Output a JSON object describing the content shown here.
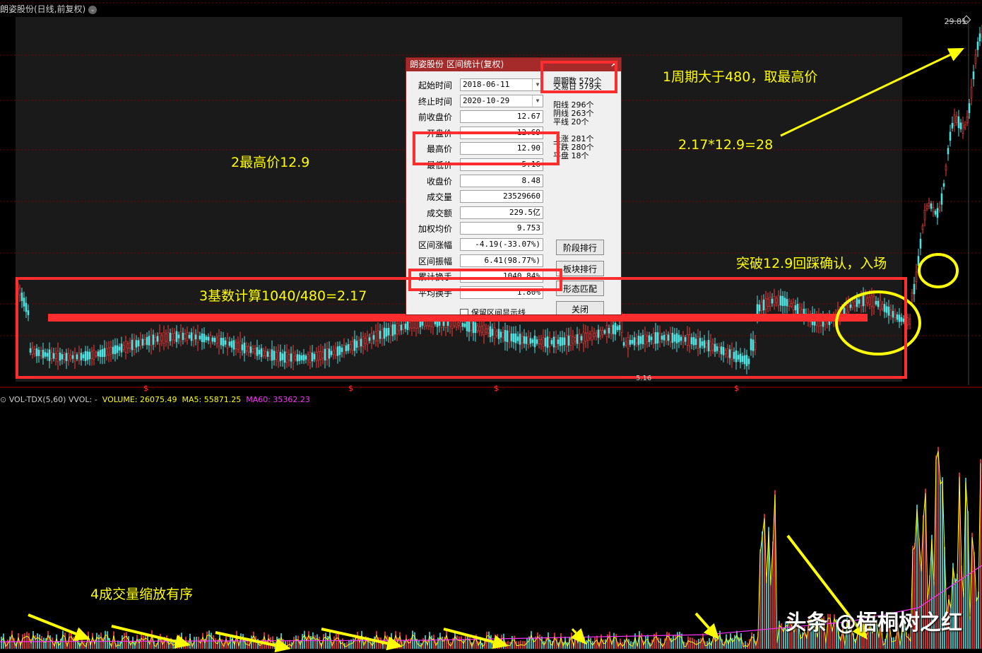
{
  "header": {
    "stock_title": "朗姿股份(日线,前复权)",
    "menu_icon": "chevron-down-icon"
  },
  "price_axis": {
    "high_label": "29.81"
  },
  "volume_header": {
    "indicator": "VOL-TDX(5,60)",
    "vvol": "VVOL: -",
    "volume": "VOLUME: 26075.49",
    "ma5": "MA5: 55871.25",
    "ma60": "MA60: 35362.23",
    "colors": {
      "volume": "#ffff00",
      "ma5": "#ffff00",
      "ma60": "#ff33ff",
      "label": "#cfcfcf"
    }
  },
  "dialog": {
    "title": "朗姿股份 区间统计(复权)",
    "close_icon": "close-icon",
    "rows": [
      {
        "label": "起始时间",
        "value": "2018-06-11",
        "type": "date"
      },
      {
        "label": "终止时间",
        "value": "2020-10-29",
        "type": "date"
      },
      {
        "label": "前收盘价",
        "value": "12.67",
        "type": "field"
      },
      {
        "label": "开盘价",
        "value": "12.69",
        "type": "field"
      },
      {
        "label": "最高价",
        "value": "12.90",
        "type": "field"
      },
      {
        "label": "最低价",
        "value": "5.16",
        "type": "field"
      },
      {
        "label": "收盘价",
        "value": "8.48",
        "type": "field"
      },
      {
        "label": "成交量",
        "value": "23529660",
        "type": "field"
      },
      {
        "label": "成交额",
        "value": "229.5亿",
        "type": "field"
      },
      {
        "label": "加权均价",
        "value": "9.753",
        "type": "field"
      },
      {
        "label": "区间涨幅",
        "value": "-4.19(-33.07%)",
        "type": "field"
      },
      {
        "label": "区间振幅",
        "value": "6.41(98.77%)",
        "type": "field"
      },
      {
        "label": "累计换手",
        "value": "1040.84%",
        "type": "field"
      },
      {
        "label": "平均换手",
        "value": "1.80%",
        "type": "field"
      }
    ],
    "stats": {
      "periods_label": "周期数",
      "periods_value": "579个",
      "trade_days_label": "交易日",
      "trade_days_value": "579天",
      "yang_label": "阳线",
      "yang_value": "296个",
      "yin_label": "阴线",
      "yin_value": "263个",
      "flat_label": "平线",
      "flat_value": "20个",
      "up_label": "上涨",
      "up_value": "281个",
      "down_label": "下跌",
      "down_value": "280个",
      "level_label": "平盘",
      "level_value": "18个"
    },
    "buttons": {
      "stage_rank": "阶段排行",
      "sector_rank": "板块排行",
      "pattern_match": "形态匹配",
      "close": "关闭"
    },
    "checkbox_label": "保留区间显示线"
  },
  "annotations": {
    "a1": "1周期大于480，取最高价",
    "a2": "2最高价12.9",
    "a3": "3基数计算1040/480=2.17",
    "a4": "4成交量缩放有序",
    "a5": "2.17*12.9=28",
    "a6": "突破12.9回踩确认，入场",
    "color": "#ffff00"
  },
  "markers": {
    "dividend": "$"
  },
  "low_label": "5.16",
  "watermark": "头条 @梧桐树之红"
}
